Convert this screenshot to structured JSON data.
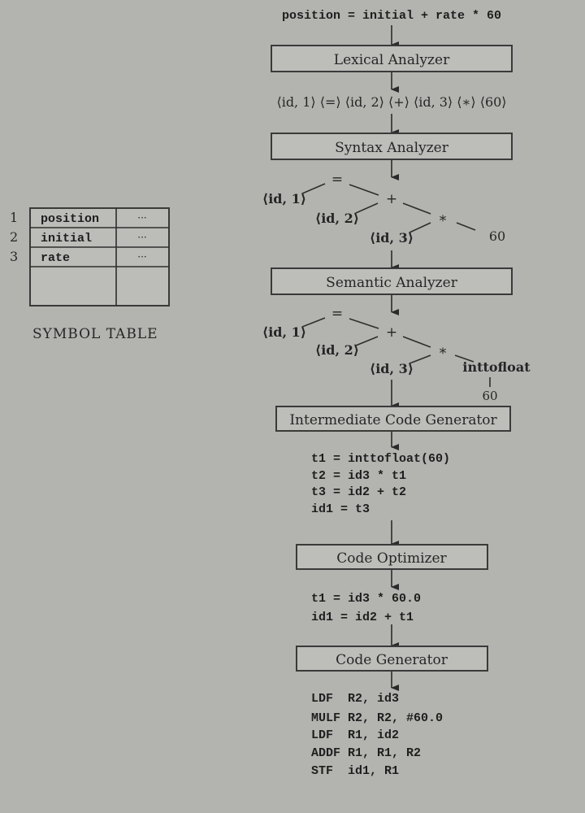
{
  "source": "position = initial + rate * 60",
  "phases": {
    "lexical": "Lexical Analyzer",
    "syntax": "Syntax Analyzer",
    "semantic": "Semantic Analyzer",
    "intermediate": "Intermediate Code Generator",
    "optimizer": "Code Optimizer",
    "generator": "Code Generator"
  },
  "tokens": "⟨id, 1⟩ ⟨=⟩ ⟨id, 2⟩ ⟨+⟩ ⟨id, 3⟩ ⟨∗⟩ ⟨60⟩",
  "syntax_tree": {
    "assign": "=",
    "id1": "⟨id, 1⟩",
    "plus": "+",
    "id2": "⟨id, 2⟩",
    "times": "*",
    "id3": "⟨id, 3⟩",
    "num": "60"
  },
  "semantic_tree": {
    "assign": "=",
    "id1": "⟨id, 1⟩",
    "plus": "+",
    "id2": "⟨id, 2⟩",
    "times": "*",
    "id3": "⟨id, 3⟩",
    "conv": "inttofloat",
    "num": "60"
  },
  "intermediate_code": [
    "t1 = inttofloat(60)",
    "t2 = id3 * t1",
    "t3 = id2 + t2",
    "id1 = t3"
  ],
  "optimized_code": [
    "t1 = id3 * 60.0",
    "id1 = id2 + t1"
  ],
  "target_code": [
    "LDF  R2, id3",
    "MULF R2, R2, #60.0",
    "LDF  R1, id2",
    "ADDF R1, R1, R2",
    "STF  id1, R1"
  ],
  "symbol_table": {
    "caption": "SYMBOL TABLE",
    "rows": [
      {
        "index": "1",
        "name": "position",
        "info": "···"
      },
      {
        "index": "2",
        "name": "initial",
        "info": "···"
      },
      {
        "index": "3",
        "name": "rate",
        "info": "···"
      }
    ]
  }
}
